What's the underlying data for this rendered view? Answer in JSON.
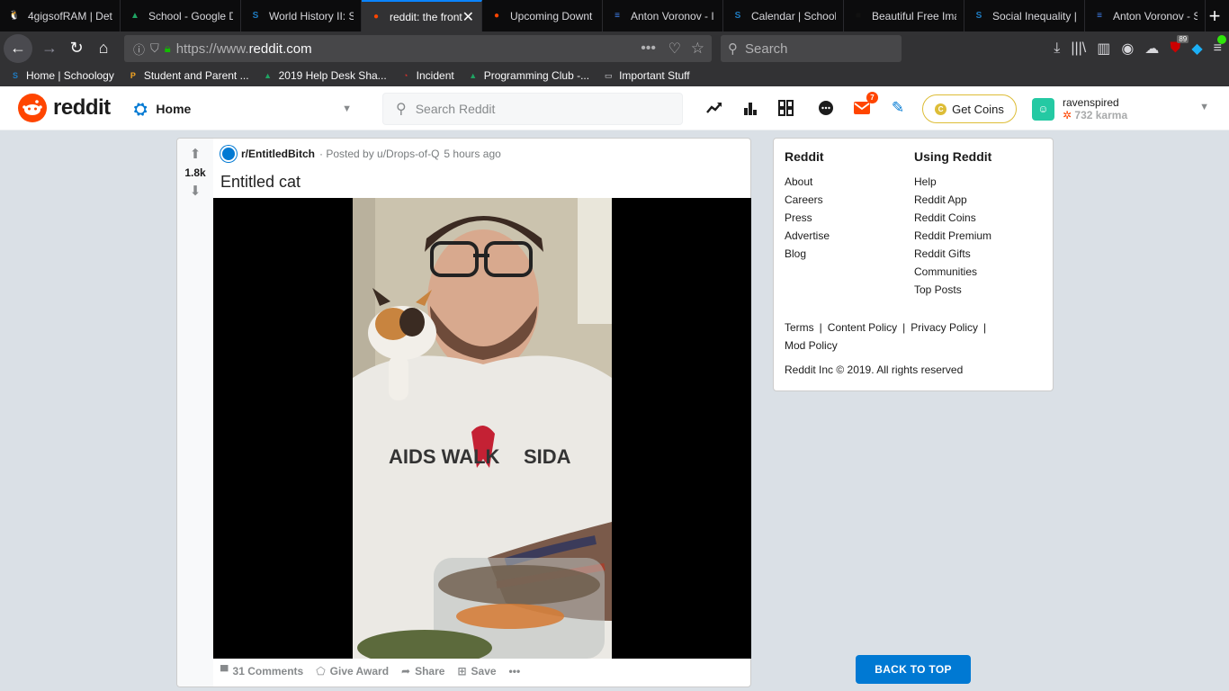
{
  "browser": {
    "tabs": [
      {
        "title": "4gigsofRAM | Det",
        "fav": "🐧",
        "color": "#f0b429"
      },
      {
        "title": "School - Google D",
        "fav": "▲",
        "color": "#1fa463"
      },
      {
        "title": "World History II: S",
        "fav": "S",
        "color": "#1f7cc2"
      },
      {
        "title": "reddit: the front",
        "fav": "●",
        "color": "#ff4500",
        "active": true
      },
      {
        "title": "Upcoming Downt",
        "fav": "●",
        "color": "#ff4500"
      },
      {
        "title": "Anton Voronov - I",
        "fav": "≡",
        "color": "#4285f4"
      },
      {
        "title": "Calendar | School",
        "fav": "S",
        "color": "#1f7cc2"
      },
      {
        "title": "Beautiful Free Ima",
        "fav": "■",
        "color": "#111"
      },
      {
        "title": "Social Inequality |",
        "fav": "S",
        "color": "#1f7cc2"
      },
      {
        "title": "Anton Voronov - S",
        "fav": "≡",
        "color": "#4285f4"
      }
    ],
    "new_tab": "+",
    "url_prefix": "https://www.",
    "url_domain": "reddit.com",
    "search_placeholder": "Search",
    "addon_badge": "89",
    "bookmarks": [
      {
        "label": "Home | Schoology",
        "fav": "S",
        "color": "#1f7cc2"
      },
      {
        "label": "Student and Parent ...",
        "fav": "P",
        "color": "#f5a623"
      },
      {
        "label": "2019 Help Desk Sha...",
        "fav": "▲",
        "color": "#1fa463"
      },
      {
        "label": "Incident",
        "fav": "◔",
        "color": "#e0312b"
      },
      {
        "label": "Programming Club -...",
        "fav": "▲",
        "color": "#1fa463"
      },
      {
        "label": "Important Stuff",
        "fav": "▭",
        "color": "#d7d7db"
      }
    ]
  },
  "reddit": {
    "logo_text": "reddit",
    "home_label": "Home",
    "search_placeholder": "Search Reddit",
    "mail_badge": "7",
    "get_coins": "Get Coins",
    "username": "ravenspired",
    "karma": "732 karma"
  },
  "post": {
    "score": "1.8k",
    "subreddit": "r/EntitledBitch",
    "posted_by": "· Posted by u/Drops-of-Q",
    "time_ago": "5 hours ago",
    "title": "Entitled cat",
    "actions": {
      "comments": "31 Comments",
      "give_award": "Give Award",
      "share": "Share",
      "save": "Save",
      "more": "•••"
    }
  },
  "sidebar": {
    "col1_title": "Reddit",
    "col1_links": [
      "About",
      "Careers",
      "Press",
      "Advertise",
      "Blog"
    ],
    "col2_title": "Using Reddit",
    "col2_links": [
      "Help",
      "Reddit App",
      "Reddit Coins",
      "Reddit Premium",
      "Reddit Gifts",
      "Communities",
      "Top Posts"
    ],
    "policy": {
      "terms": "Terms",
      "content_policy": "Content Policy",
      "privacy_policy": "Privacy Policy",
      "mod_policy": "Mod Policy"
    },
    "copyright": "Reddit Inc © 2019. All rights reserved"
  },
  "back_to_top": "BACK TO TOP"
}
